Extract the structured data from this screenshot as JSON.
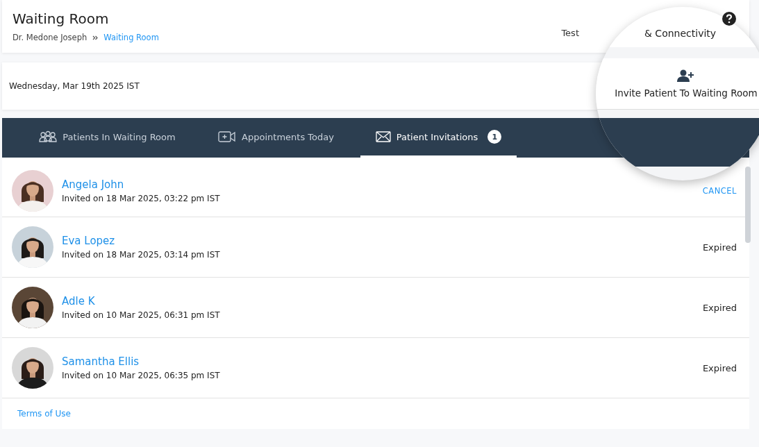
{
  "header": {
    "title": "Waiting Room",
    "breadcrumb": [
      {
        "label": "Dr. Medone Joseph",
        "kind": "text"
      },
      {
        "label": "Waiting Room",
        "kind": "link"
      }
    ],
    "test_link_partial": "Test"
  },
  "date": "Wednesday, Mar 19th 2025 IST",
  "magnifier": {
    "connectivity_text": "& Connectivity",
    "invite_button": "Invite Patient To Waiting Room"
  },
  "tabs": [
    {
      "label": "Patients In Waiting Room",
      "selected": false
    },
    {
      "label": "Appointments Today",
      "selected": false
    },
    {
      "label": "Patient Invitations",
      "selected": true,
      "badge": "1"
    }
  ],
  "invitations": [
    {
      "name": "Angela John",
      "invited": "Invited on 18 Mar 2025, 03:22 pm IST",
      "status": "CANCEL",
      "kind": "action"
    },
    {
      "name": "Eva Lopez",
      "invited": "Invited on 18 Mar 2025, 03:14 pm IST",
      "status": "Expired",
      "kind": "status"
    },
    {
      "name": "Adle K",
      "invited": "Invited on 10 Mar 2025, 06:31 pm IST",
      "status": "Expired",
      "kind": "status"
    },
    {
      "name": "Samantha Ellis",
      "invited": "Invited on 10 Mar 2025, 06:35 pm IST",
      "status": "Expired",
      "kind": "status"
    }
  ],
  "footer": {
    "link": "Terms of Use"
  }
}
